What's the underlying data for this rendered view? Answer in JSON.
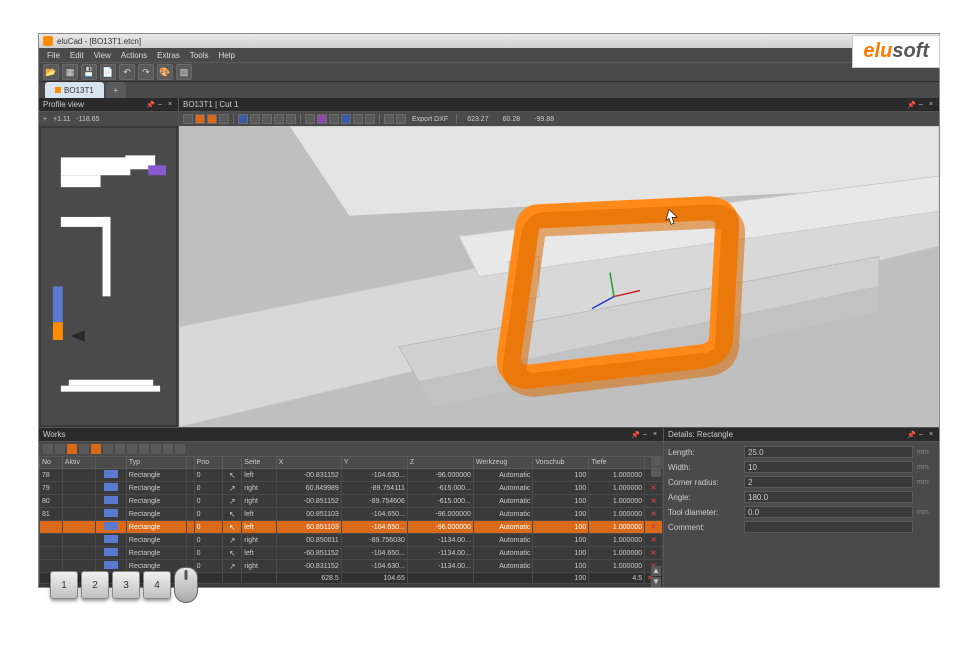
{
  "window": {
    "title": "eluCad - [BO13T1.etcn]"
  },
  "menu": [
    "File",
    "Edit",
    "View",
    "Actions",
    "Extras",
    "Tools",
    "Help"
  ],
  "tab": {
    "label": "BO13T1"
  },
  "profile": {
    "title": "Profile view",
    "coord_x": "+1.11",
    "coord_y": "-118.65"
  },
  "viewport": {
    "title": "BO13T1 | Cut 1",
    "export_label": "Export DXF",
    "coords": [
      "623.27",
      "60.28",
      "-99.88"
    ]
  },
  "works": {
    "title": "Works",
    "headers": [
      "No",
      "Aktiv",
      "",
      "Typ",
      "",
      "Prio",
      "",
      "Seite",
      "X",
      "Y",
      "Z",
      "Werkzeug",
      "Vorschub",
      "Tiefe",
      ""
    ],
    "rows": [
      {
        "no": "78",
        "typ": "Rectangle",
        "prio": "0",
        "side_dir": "left",
        "side": "left",
        "x": "-00.831152",
        "y": "-104.630...",
        "z": "-96.000000",
        "wk": "Automatic",
        "vs": "100",
        "t": "1.000000"
      },
      {
        "no": "79",
        "typ": "Rectangle",
        "prio": "0",
        "side_dir": "right",
        "side": "right",
        "x": "60.849989",
        "y": "-89.754111",
        "z": "-615.000...",
        "wk": "Automatic",
        "vs": "100",
        "t": "1.000000"
      },
      {
        "no": "80",
        "typ": "Rectangle",
        "prio": "0",
        "side_dir": "right",
        "side": "right",
        "x": "-00.851152",
        "y": "-89.754606",
        "z": "-615.000...",
        "wk": "Automatic",
        "vs": "100",
        "t": "1.000000"
      },
      {
        "no": "81",
        "typ": "Rectangle",
        "prio": "0",
        "side_dir": "left",
        "side": "left",
        "x": "00.851103",
        "y": "-104.650...",
        "z": "-96.000000",
        "wk": "Automatic",
        "vs": "100",
        "t": "1.000000"
      },
      {
        "no": "",
        "typ": "Rectangle",
        "prio": "0",
        "side_dir": "left",
        "side": "left",
        "x": "60.851103",
        "y": "-104.650...",
        "z": "-96.000000",
        "wk": "Automatic",
        "vs": "100",
        "t": "1.000000",
        "sel": true
      },
      {
        "no": "",
        "typ": "Rectangle",
        "prio": "0",
        "side_dir": "right",
        "side": "right",
        "x": "00.850011",
        "y": "-89.756030",
        "z": "-1134.00...",
        "wk": "Automatic",
        "vs": "100",
        "t": "1.000000"
      },
      {
        "no": "",
        "typ": "Rectangle",
        "prio": "0",
        "side_dir": "left",
        "side": "left",
        "x": "-60.851152",
        "y": "-104.650...",
        "z": "-1134.00...",
        "wk": "Automatic",
        "vs": "100",
        "t": "1.000000"
      },
      {
        "no": "",
        "typ": "Rectangle",
        "prio": "0",
        "side_dir": "right",
        "side": "right",
        "x": "-00.831152",
        "y": "-104.630...",
        "z": "-1134.00...",
        "wk": "Automatic",
        "vs": "100",
        "t": "1.000000"
      }
    ],
    "footer": {
      "x": "628.5",
      "y": "104.65",
      "vs": "100",
      "t": "4.5"
    }
  },
  "details": {
    "title": "Details: Rectangle",
    "fields": [
      {
        "label": "Length:",
        "value": "25.0",
        "unit": "mm"
      },
      {
        "label": "Width:",
        "value": "10",
        "unit": "mm"
      },
      {
        "label": "Corner radius:",
        "value": "2",
        "unit": "mm"
      },
      {
        "label": "Angle:",
        "value": "180.0",
        "unit": ""
      },
      {
        "label": "Tool diameter:",
        "value": "0.0",
        "unit": "mm"
      },
      {
        "label": "Comment:",
        "value": "",
        "unit": ""
      }
    ]
  },
  "keys": [
    "1",
    "2",
    "3",
    "4"
  ],
  "logo": {
    "part1": "elu",
    "part2": "soft"
  }
}
